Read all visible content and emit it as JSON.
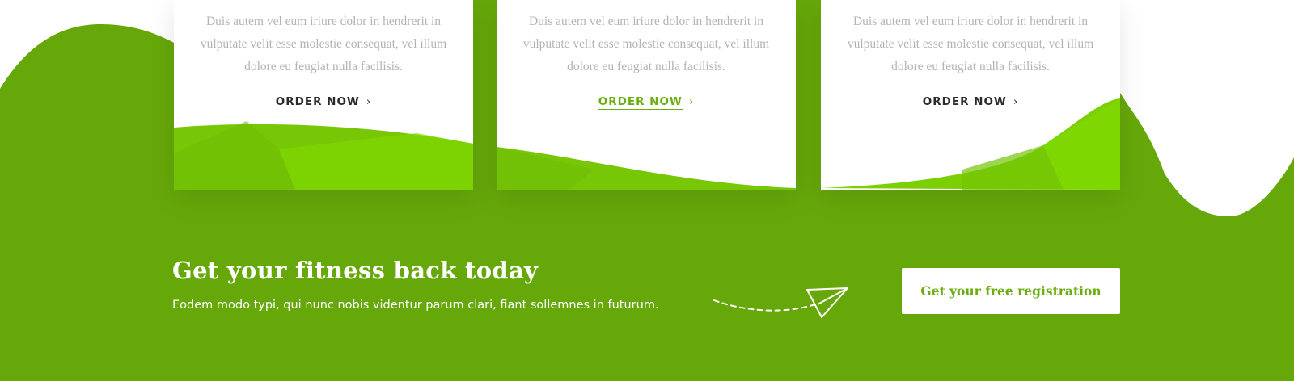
{
  "colors": {
    "brand_green": "#66a80a",
    "light_green": "#80da00",
    "dark_text": "#2b2b2b",
    "muted_text": "#b3b3b3",
    "white": "#ffffff"
  },
  "cards": [
    {
      "description": "Duis autem vel eum iriure dolor in hendrerit in vulputate velit esse molestie consequat, vel illum dolore eu feugiat nulla facilisis.",
      "order_label": "ORDER NOW",
      "active": false
    },
    {
      "description": "Duis autem vel eum iriure dolor in hendrerit in vulputate velit esse molestie consequat, vel illum dolore eu feugiat nulla facilisis.",
      "order_label": "ORDER NOW",
      "active": true
    },
    {
      "description": "Duis autem vel eum iriure dolor in hendrerit in vulputate velit esse molestie consequat, vel illum dolore eu feugiat nulla facilisis.",
      "order_label": "ORDER NOW",
      "active": false
    }
  ],
  "cta": {
    "title": "Get your fitness back today",
    "subtitle": "Eodem modo typi, qui nunc nobis videntur parum clari, fiant sollemnes in futurum.",
    "button_label": "Get your free registration",
    "decor_icon": "paper-plane-icon"
  }
}
